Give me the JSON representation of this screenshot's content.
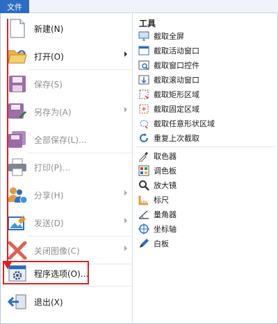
{
  "tab": {
    "file_label": "文件"
  },
  "menu": {
    "new": "新建(N)",
    "open": "打开(O)",
    "save": "保存(S)",
    "save_as": "另存为(A)",
    "save_all": "全部保存(L)...",
    "print": "打印(P)...",
    "share": "分享(H)",
    "send": "发送(D)",
    "close_image": "关闭图像(C)",
    "options": "程序选项(O)...",
    "exit": "退出(X)"
  },
  "tools": {
    "title": "工具",
    "items": [
      {
        "label": "截取全屏",
        "icon": "monitor-icon"
      },
      {
        "label": "截取活动窗口",
        "icon": "window-icon"
      },
      {
        "label": "截取窗口控件",
        "icon": "window-control-icon"
      },
      {
        "label": "截取滚动窗口",
        "icon": "scroll-window-icon"
      },
      {
        "label": "截取矩形区域",
        "icon": "rectangle-region-icon"
      },
      {
        "label": "截取固定区域",
        "icon": "fixed-region-icon"
      },
      {
        "label": "截取任意形状区域",
        "icon": "freehand-region-icon"
      },
      {
        "label": "重复上次截取",
        "icon": "repeat-icon"
      },
      {
        "label": "取色器",
        "icon": "eyedropper-icon"
      },
      {
        "label": "调色板",
        "icon": "palette-icon"
      },
      {
        "label": "放大镜",
        "icon": "magnifier-icon"
      },
      {
        "label": "标尺",
        "icon": "ruler-icon"
      },
      {
        "label": "量角器",
        "icon": "protractor-icon"
      },
      {
        "label": "坐标轴",
        "icon": "crosshair-icon"
      },
      {
        "label": "白板",
        "icon": "pen-icon"
      }
    ]
  },
  "colors": {
    "accent": "#2b6cc4",
    "annotation": "#e02020",
    "disabled_text": "#8f8f8f"
  }
}
